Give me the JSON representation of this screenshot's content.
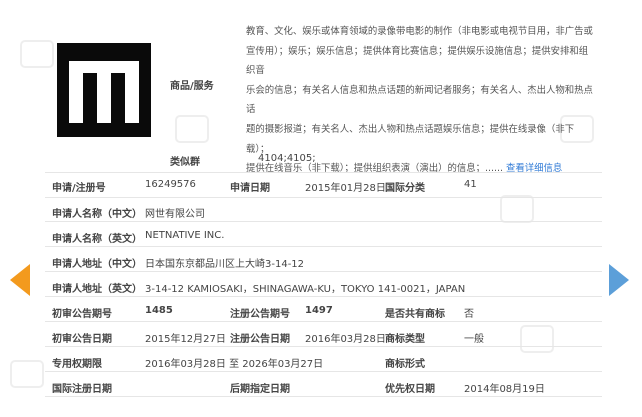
{
  "logo_text": "M",
  "goods": {
    "label": "商品/服务",
    "lines": [
      "教育、文化、娱乐或体育领域的录像带电影的制作（非电影或电视节目用，非广告或",
      "宣传用）；娱乐；娱乐信息；提供体育比赛信息；提供娱乐设施信息；提供安排和组织音",
      "乐会的信息；有关名人信息和热点话题的新闻记者服务；有关名人、杰出人物和热点话",
      "题的摄影报道；有关名人、杰出人物和热点话题娱乐信息；提供在线录像（非下载）；",
      "提供在线音乐（非下载）；提供组织表演（演出）的信息；......"
    ],
    "more_link": "查看详细信息"
  },
  "similar_group": {
    "label": "类似群",
    "value": "4104;4105;"
  },
  "fields": {
    "reg_no": {
      "label": "申请/注册号",
      "value": "16249576"
    },
    "app_date": {
      "label": "申请日期",
      "value": "2015年01月28日"
    },
    "intl_class": {
      "label": "国际分类",
      "value": "41"
    },
    "applicant_cn": {
      "label": "申请人名称（中文）",
      "value": "网世有限公司"
    },
    "applicant_en": {
      "label": "申请人名称（英文）",
      "value": "NETNATIVE INC."
    },
    "address_cn": {
      "label": "申请人地址（中文）",
      "value": "日本国东京都品川区上大崎3-14-12"
    },
    "address_en": {
      "label": "申请人地址（英文）",
      "value": "3-14-12 KAMIOSAKI，SHINAGAWA-KU，TOKYO 141-0021，JAPAN"
    },
    "prelim_no": {
      "label": "初审公告期号",
      "value": "1485"
    },
    "reg_pub_no": {
      "label": "注册公告期号",
      "value": "1497"
    },
    "shared": {
      "label": "是否共有商标",
      "value": "否"
    },
    "prelim_date": {
      "label": "初审公告日期",
      "value": "2015年12月27日"
    },
    "reg_pub_date": {
      "label": "注册公告日期",
      "value": "2016年03月28日"
    },
    "tm_type": {
      "label": "商标类型",
      "value": "一般"
    },
    "exclusive": {
      "label": "专用权期限",
      "value": "2016年03月28日 至 2026年03月27日"
    },
    "tm_form": {
      "label": "商标形式",
      "value": ""
    },
    "intl_reg_date": {
      "label": "国际注册日期",
      "value": ""
    },
    "later_date": {
      "label": "后期指定日期",
      "value": ""
    },
    "priority_date": {
      "label": "优先权日期",
      "value": "2014年08月19日"
    }
  },
  "colors": {
    "prev_arrow": "#f39a1e",
    "next_arrow": "#5c9fd9",
    "link": "#2f7ad6"
  }
}
